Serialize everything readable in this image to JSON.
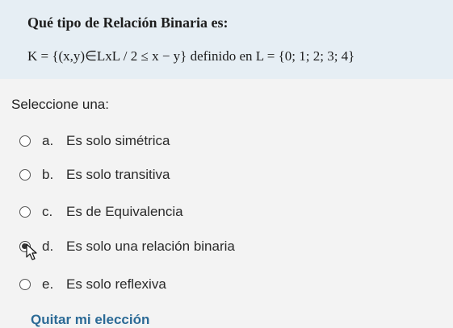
{
  "question": {
    "title": "Qué tipo de Relación Binaria es:",
    "formula": "K = {(x,y)∈LxL / 2 ≤ x − y} definido en L = {0; 1; 2; 3; 4}"
  },
  "prompt": "Seleccione una:",
  "options": [
    {
      "letter": "a.",
      "text": "Es solo simétrica",
      "selected": false
    },
    {
      "letter": "b.",
      "text": "Es solo transitiva",
      "selected": false
    },
    {
      "letter": "c.",
      "text": "Es de Equivalencia",
      "selected": false
    },
    {
      "letter": "d.",
      "text": "Es solo una relación binaria",
      "selected": true
    },
    {
      "letter": "e.",
      "text": "Es solo reflexiva",
      "selected": false
    }
  ],
  "clear_label": "Quitar mi elección",
  "colors": {
    "link": "#2b6a96",
    "question_bg": "#e6eef4",
    "page_bg": "#f3f3f3"
  }
}
